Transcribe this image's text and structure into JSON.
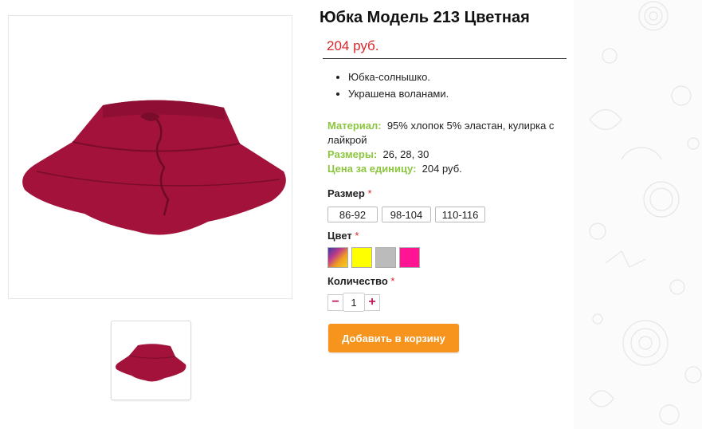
{
  "product": {
    "title": "Юбка Модель 213 Цветная",
    "price": "204 руб.",
    "features": [
      "Юбка-солнышко.",
      "Украшена воланами."
    ],
    "specs": {
      "material_label": "Материал:",
      "material_value": "95% хлопок 5% эластан, кулирка с лайкрой",
      "sizes_label": "Размеры:",
      "sizes_value": "26, 28, 30",
      "unit_price_label": "Цена за единицу:",
      "unit_price_value": "204 руб."
    }
  },
  "options": {
    "size_label": "Размер",
    "size_options": [
      "86-92",
      "98-104",
      "110-116"
    ],
    "color_label": "Цвет",
    "color_swatches": [
      {
        "name": "multicolor",
        "color": "gradient"
      },
      {
        "name": "yellow",
        "color": "#ffff00"
      },
      {
        "name": "grey",
        "color": "#bbbbbb"
      },
      {
        "name": "pink",
        "color": "#ff1493"
      }
    ],
    "quantity_label": "Количество",
    "required_mark": "*",
    "quantity_value": "1",
    "minus": "−",
    "plus": "+"
  },
  "cart": {
    "add_button": "Добавить в корзину"
  },
  "colors": {
    "price": "#d8262b",
    "spec_label": "#8cc63f",
    "button": "#f7941d",
    "skirt": "#a3123a"
  }
}
